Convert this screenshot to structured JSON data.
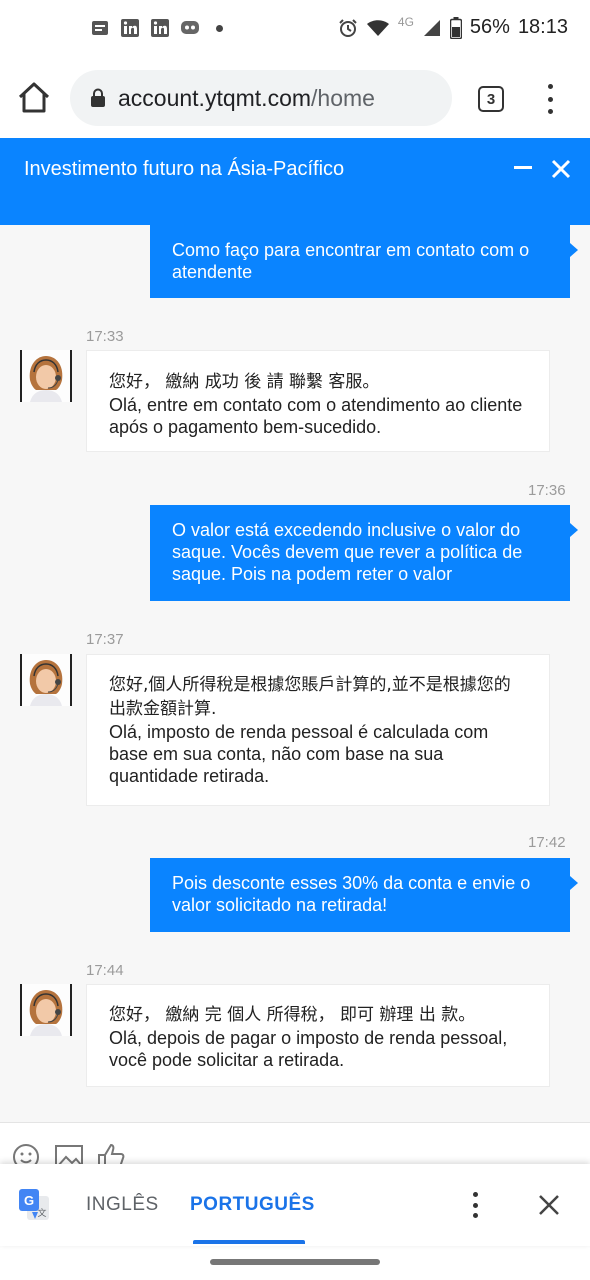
{
  "status_bar": {
    "battery": "56%",
    "time": "18:13",
    "network": "4G",
    "icons": [
      "news-icon",
      "linkedin-icon",
      "linkedin-icon",
      "messenger-icon",
      "alarm-icon",
      "wifi-icon",
      "signal-icon",
      "battery-icon"
    ]
  },
  "browser": {
    "url_host": "account.ytqmt.com",
    "url_path": "/home",
    "tab_count": "3"
  },
  "chat": {
    "title": "Investimento futuro na Ásia-Pacífico",
    "messages": [
      {
        "dir": "out",
        "text": "Como faço para encontrar em contato com o atendente"
      },
      {
        "dir": "in",
        "time": "17:33",
        "zh": "您好， 繳納 成功 後 請 聯繫 客服。",
        "text": "Olá, entre em contato com o atendimento ao cliente após o pagamento bem-sucedido."
      },
      {
        "dir": "out",
        "time": "17:36",
        "text": "O valor está excedendo inclusive o valor do saque. Vocês devem que rever a política de saque. Pois na podem reter o valor"
      },
      {
        "dir": "in",
        "time": "17:37",
        "zh": "您好,個人所得稅是根據您賬戶計算的,並不是根據您的出款金額計算.",
        "text": "Olá, imposto de renda pessoal é calculada com base em sua conta, não com base na sua quantidade retirada."
      },
      {
        "dir": "out",
        "time": "17:42",
        "text": "Pois desconte esses 30% da conta e envie o valor solicitado na retirada!"
      },
      {
        "dir": "in",
        "time": "17:44",
        "zh": "您好， 繳納 完 個人 所得稅， 即可 辦理 出 款。",
        "text": "Olá, depois de pagar o imposto de renda pessoal, você pode solicitar a retirada."
      }
    ],
    "tools": [
      "emoji-icon",
      "image-icon",
      "thumbs-up-icon"
    ]
  },
  "translate": {
    "lang_source": "INGLÊS",
    "lang_target": "PORTUGUÊS"
  },
  "colors": {
    "accent": "#0a84ff",
    "translate_blue": "#1a73e8"
  }
}
